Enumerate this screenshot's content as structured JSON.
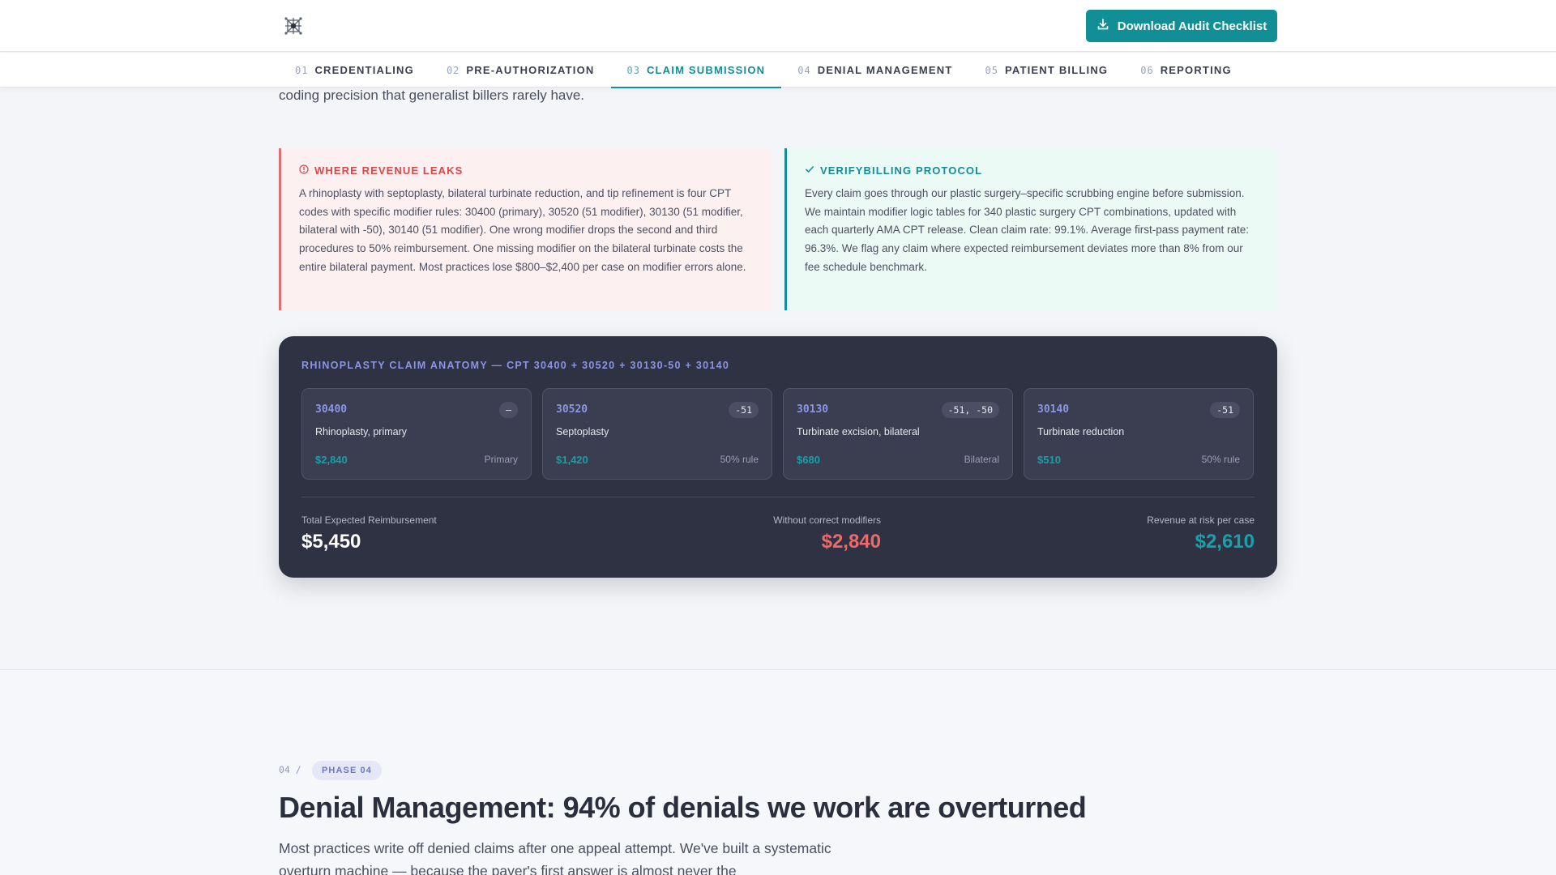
{
  "header": {
    "logo_icon": "network-star-icon",
    "download_label": "Download Audit Checklist",
    "download_icon": "download-icon",
    "accent_color": "#118e96"
  },
  "tabs": [
    {
      "num": "01",
      "label": "CREDENTIALING",
      "active": false
    },
    {
      "num": "02",
      "label": "PRE-AUTHORIZATION",
      "active": false
    },
    {
      "num": "03",
      "label": "CLAIM SUBMISSION",
      "active": true
    },
    {
      "num": "04",
      "label": "DENIAL MANAGEMENT",
      "active": false
    },
    {
      "num": "05",
      "label": "PATIENT BILLING",
      "active": false
    },
    {
      "num": "06",
      "label": "REPORTING",
      "active": false
    }
  ],
  "section3": {
    "lead_fragment": "coding precision that generalist billers rarely have.",
    "leak": {
      "icon": "alert-circle-icon",
      "title": "WHERE REVENUE LEAKS",
      "body": "A rhinoplasty with septoplasty, bilateral turbinate reduction, and tip refinement is four CPT codes with specific modifier rules: 30400 (primary), 30520 (51 modifier), 30130 (51 modifier, bilateral with -50), 30140 (51 modifier). One wrong modifier drops the second and third procedures to 50% reimbursement. One missing modifier on the bilateral turbinate costs the entire bilateral payment. Most practices lose $800–$2,400 per case on modifier errors alone."
    },
    "protocol": {
      "icon": "check-icon",
      "title": "VERIFYBILLING PROTOCOL",
      "body": "Every claim goes through our plastic surgery–specific scrubbing engine before submission. We maintain modifier logic tables for 340 plastic surgery CPT combinations, updated with each quarterly AMA CPT release. Clean claim rate: 99.1%. Average first-pass payment rate: 96.3%. We flag any claim where expected reimbursement deviates more than 8% from our fee schedule benchmark."
    },
    "anatomy": {
      "title": "RHINOPLASTY CLAIM ANATOMY — CPT 30400 + 30520 + 30130-50 + 30140",
      "codes": [
        {
          "code": "30400",
          "modifier": "—",
          "desc": "Rhinoplasty, primary",
          "price": "$2,840",
          "rule": "Primary"
        },
        {
          "code": "30520",
          "modifier": "-51",
          "desc": "Septoplasty",
          "price": "$1,420",
          "rule": "50% rule"
        },
        {
          "code": "30130",
          "modifier": "-51, -50",
          "desc": "Turbinate excision, bilateral",
          "price": "$680",
          "rule": "Bilateral"
        },
        {
          "code": "30140",
          "modifier": "-51",
          "desc": "Turbinate reduction",
          "price": "$510",
          "rule": "50% rule"
        }
      ],
      "summary": {
        "total_label": "Total Expected Reimbursement",
        "total_value": "$5,450",
        "without_label": "Without correct modifiers",
        "without_value": "$2,840",
        "risk_label": "Revenue at risk per case",
        "risk_value": "$2,610"
      }
    }
  },
  "section4": {
    "index": "04 /",
    "badge": "PHASE 04",
    "title": "Denial Management: 94% of denials we work are overturned",
    "intro": "Most practices write off denied claims after one appeal attempt. We've built a systematic overturn machine — because the payer's first answer is almost never the"
  }
}
